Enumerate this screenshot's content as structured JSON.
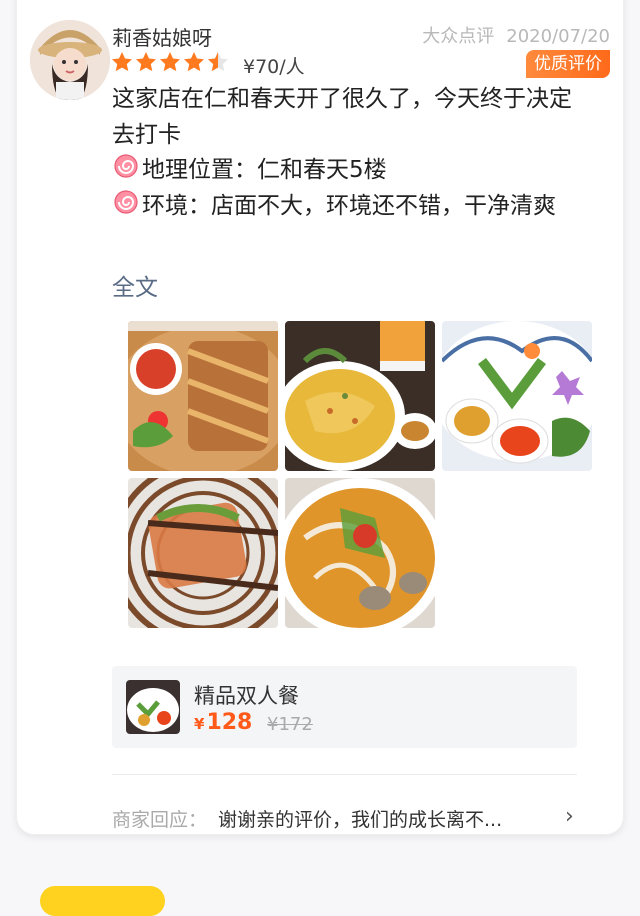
{
  "user": {
    "name": "莉香姑娘呀",
    "rating": 4.5,
    "price_per_person": "¥70/人",
    "source": "大众点评",
    "date": "2020/07/20",
    "badge": "优质评价"
  },
  "review": {
    "line1": "这家店在仁和春天开了很久了，今天终于决定去打卡",
    "line2": "地理位置：仁和春天5楼",
    "line3": "环境：店面不大，环境还不错，干净清爽",
    "full_text_link": "全文",
    "bullet_icon": "lollipop-icon"
  },
  "photos": [
    "grilled-chicken-platter",
    "fried-rice-with-drink",
    "salad-rolls-with-sauces",
    "spring-roll-with-chopsticks",
    "curry-soup"
  ],
  "deal": {
    "name": "精品双人餐",
    "currency": "¥",
    "price": "128",
    "original_price": "¥172"
  },
  "merchant_reply": {
    "label": "商家回应：",
    "text": "谢谢亲的评价，我们的成长离不...",
    "arrow": "›"
  },
  "colors": {
    "accent": "#ff6a1a",
    "star": "#ff7a1f",
    "link": "#5a6b86",
    "bottom_button": "#ffd21f"
  }
}
